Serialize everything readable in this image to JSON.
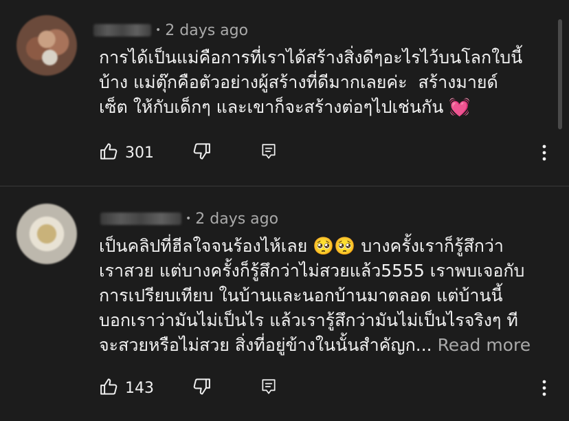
{
  "comments": [
    {
      "time": "2 days ago",
      "text_lines": [
        "การได้เป็นแม่คือการที่เราได้สร้างสิ่งดีๆอะไรไว้บนโลกใบนี้",
        "บ้าง แม่ตุ๊กคือตัวอย่างผู้สร้างที่ดีมากเลยค่ะ  สร้างมายด์",
        "เซ็ต ให้กับเด็กๆ และเขาก็จะสร้างต่อๆไปเช่นกัน 💓"
      ],
      "likes": "301"
    },
    {
      "time": "2 days ago",
      "text_lines": [
        "เป็นคลิปที่ฮีลใจจนร้องไห้เลย 🥺🥺 บางครั้งเราก็รู้สึกว่า",
        "เราสวย แต่บางครั้งก็รู้สึกว่าไม่สวยแล้ว5555 เราพบเจอกับ",
        "การเปรียบเทียบ ในบ้านและนอกบ้านมาตลอด แต่บ้านนี้",
        "บอกเราว่ามันไม่เป็นไร แล้วเรารู้สึกว่ามันไม่เป็นไรจริงๆ ที",
        "จะสวยหรือไม่สวย สิ่งที่อยู่ข้างในนั้นสำคัญก..."
      ],
      "read_more": "Read more",
      "likes": "143"
    }
  ],
  "icons": {
    "like": "thumbs-up-icon",
    "dislike": "thumbs-down-icon",
    "reply": "reply-comment-icon",
    "more": "more-vertical-icon"
  }
}
